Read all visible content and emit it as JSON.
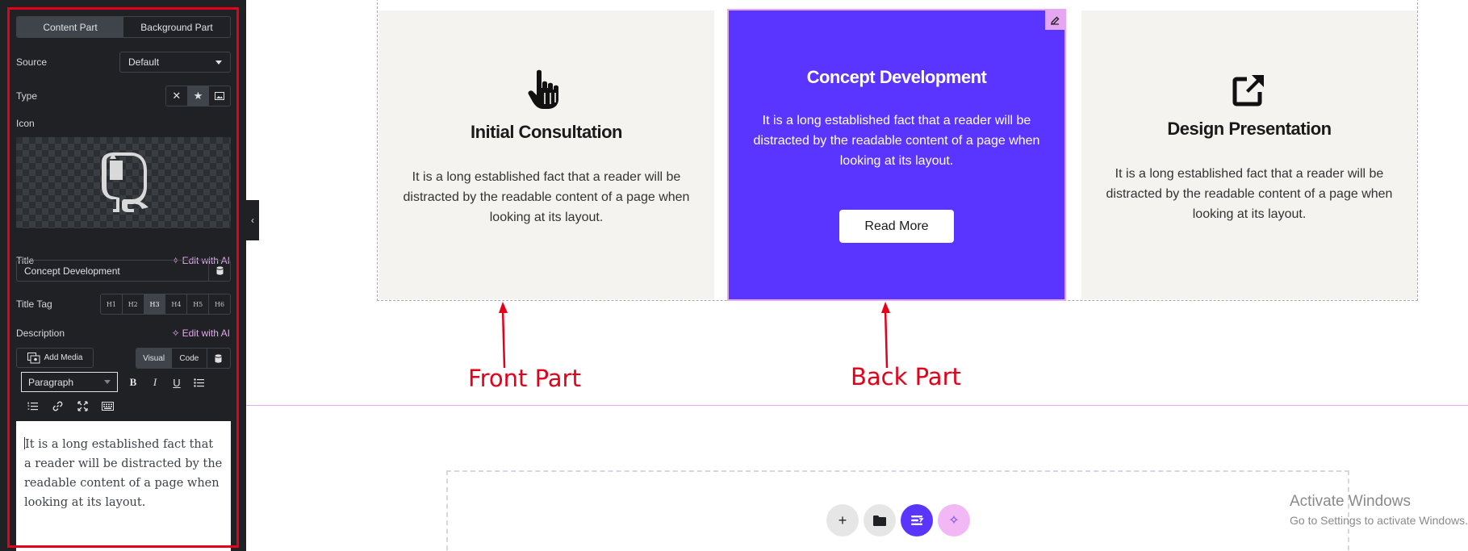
{
  "panel": {
    "tabs": [
      "Content Part",
      "Background Part"
    ],
    "source": {
      "label": "Source",
      "value": "Default"
    },
    "type": {
      "label": "Type",
      "options": [
        "none-icon",
        "star-icon",
        "image-icon"
      ],
      "selected": "star-icon"
    },
    "icon": {
      "label": "Icon",
      "preview": "evernote-elephant-icon"
    },
    "title": {
      "label": "Title",
      "ai_link": "Edit with AI",
      "value": "Concept Development"
    },
    "title_tag": {
      "label": "Title Tag",
      "options": [
        "H1",
        "H2",
        "H3",
        "H4",
        "H5",
        "H6"
      ],
      "selected": "H3"
    },
    "description": {
      "label": "Description",
      "ai_link": "Edit with AI",
      "add_media": "Add Media",
      "modes": [
        "Visual",
        "Code"
      ],
      "active_mode": "Visual",
      "format": "Paragraph",
      "content": "It is a long established fact that a reader will be distracted by the readable content of a page when looking at its layout."
    }
  },
  "cards": [
    {
      "icon": "pointer-hand-icon",
      "title": "Initial Consultation",
      "desc": "It is a long established fact that a reader will be distracted by the readable content of a page when looking at its layout."
    },
    {
      "title": "Concept Development",
      "desc": "It is a long established fact that a reader will be distracted by the readable content of a page when looking at its layout.",
      "button": "Read More"
    },
    {
      "icon": "external-link-icon",
      "title": "Design Presentation",
      "desc": "It is a long established fact that a reader will be distracted by the readable content of a page when looking at its layout."
    }
  ],
  "annotations": {
    "front": "Front Part",
    "back": "Back Part"
  },
  "watermark": {
    "title": "Activate Windows",
    "sub": "Go to Settings to activate Windows."
  },
  "colors": {
    "panel_bg": "#1f2124",
    "accent_purple": "#5a35ff",
    "ai_pink": "#e7a6f2",
    "annotation_red": "#e5001a",
    "card_bg": "#f4f3f0"
  }
}
